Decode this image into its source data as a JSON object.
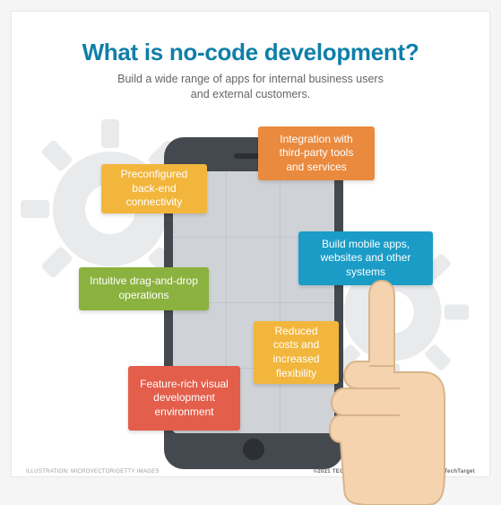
{
  "title": "What is no-code development?",
  "subtitle": "Build a wide range of apps for internal business users and external customers.",
  "boxes": {
    "integration": "Integration with third-party tools and services",
    "backend": "Preconfigured back-end connectivity",
    "mobile": "Build mobile apps, websites and other systems",
    "intuitive": "Intuitive drag-and-drop operations",
    "reduced": "Reduced costs and increased flexibility",
    "feature": "Feature-rich visual development environment"
  },
  "footer": {
    "left": "ILLUSTRATION: MICROVECTOR/GETTY IMAGES",
    "right": "©2021 TECHTARGET. ALL RIGHTS RESERVED  TechTarget"
  }
}
